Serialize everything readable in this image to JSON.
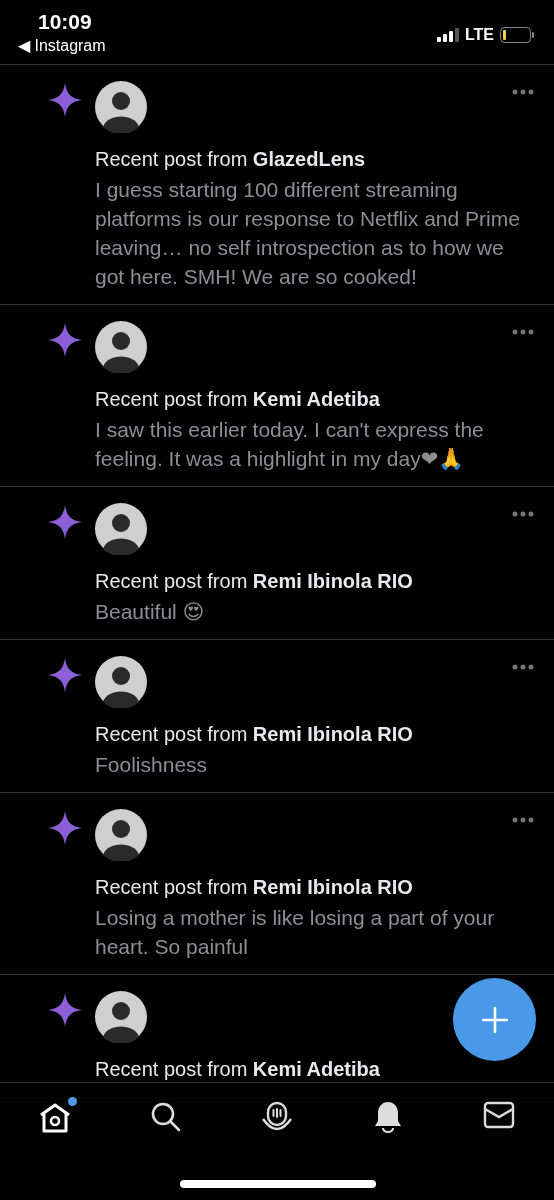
{
  "status_bar": {
    "time": "10:09",
    "back_label": "◀ Instagram",
    "network": "LTE"
  },
  "posts": [
    {
      "more_button": true,
      "prefix": "Recent post from",
      "author": "GlazedLens",
      "body": "I guess starting 100 different streaming platforms is our response to Netflix and Prime leaving… no self introspection as to how we got here. SMH! We are so cooked!"
    },
    {
      "more_button": true,
      "prefix": "Recent post from",
      "author": "Kemi Adetiba",
      "body": "I saw this earlier today. I can't express the feeling. It was a highlight in my day❤🙏"
    },
    {
      "more_button": true,
      "prefix": "Recent post from",
      "author": "Remi Ibinola RIO",
      "body": "Beautiful 😍"
    },
    {
      "more_button": true,
      "prefix": "Recent post from",
      "author": "Remi Ibinola RIO",
      "body": "Foolishness"
    },
    {
      "more_button": true,
      "prefix": "Recent post from",
      "author": "Remi Ibinola RIO",
      "body": "Losing a mother is like losing a part of your heart. So painful"
    },
    {
      "more_button": false,
      "prefix": "Recent post from",
      "author": "Kemi Adetiba"
    }
  ],
  "nav": [
    {
      "kind": "home",
      "selected": true,
      "badge": true
    },
    {
      "kind": "search",
      "selected": false,
      "badge": false
    },
    {
      "kind": "spaces",
      "selected": false,
      "badge": false
    },
    {
      "kind": "bell",
      "selected": false,
      "badge": false
    },
    {
      "kind": "mail",
      "selected": false,
      "badge": false
    }
  ]
}
